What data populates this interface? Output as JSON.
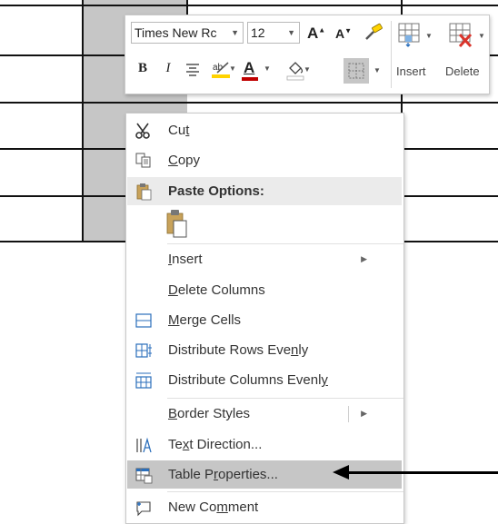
{
  "toolbar": {
    "font_name": "Times New Rc",
    "font_size": "12",
    "insert_label": "Insert",
    "delete_label": "Delete",
    "bold": "B",
    "italic": "I",
    "grow_font": "A",
    "shrink_font": "A",
    "font_color_letter": "A",
    "accent_color": "#c00000",
    "highlight_color": "#ffd300"
  },
  "menu": {
    "cut": {
      "prefix": "Cu",
      "key": "t",
      "suffix": ""
    },
    "copy": {
      "prefix": "",
      "key": "C",
      "suffix": "opy"
    },
    "paste_options": "Paste Options:",
    "insert": {
      "prefix": "",
      "key": "I",
      "suffix": "nsert"
    },
    "delete_columns": {
      "prefix": "",
      "key": "D",
      "suffix": "elete Columns"
    },
    "merge_cells": {
      "prefix": "",
      "key": "M",
      "suffix": "erge Cells"
    },
    "distribute_rows": {
      "prefix": "Distribute Rows Eve",
      "key": "n",
      "suffix": "ly"
    },
    "distribute_columns": {
      "prefix": "Distribute Columns Evenl",
      "key": "y",
      "suffix": ""
    },
    "border_styles": {
      "prefix": "",
      "key": "B",
      "suffix": "order Styles"
    },
    "text_direction": {
      "prefix": "Te",
      "key": "x",
      "suffix": "t Direction..."
    },
    "table_properties": {
      "prefix": "Table P",
      "key": "r",
      "suffix": "operties..."
    },
    "new_comment": {
      "prefix": "New Co",
      "key": "m",
      "suffix": "ment"
    }
  }
}
